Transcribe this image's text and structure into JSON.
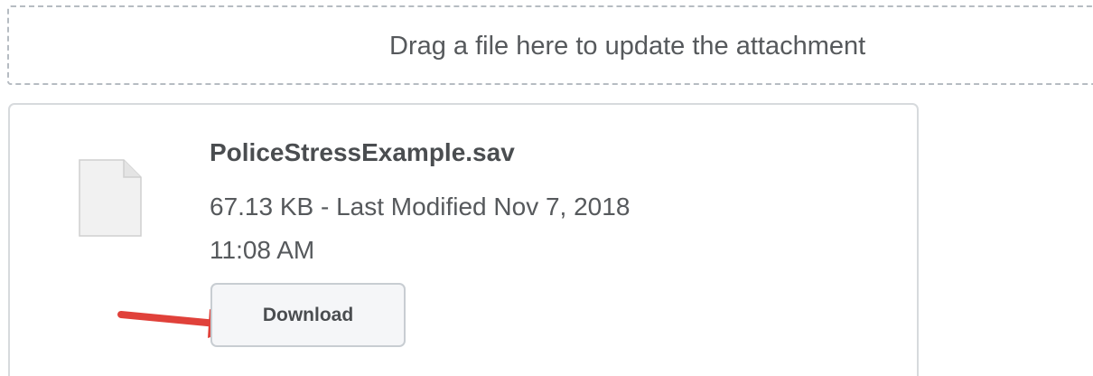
{
  "dropzone": {
    "text": "Drag a file here to update the attachment"
  },
  "attachment": {
    "file_name": "PoliceStressExample.sav",
    "meta_line_1": "67.13 KB - Last Modified Nov 7, 2018",
    "meta_line_2": "11:08 AM",
    "download_label": "Download",
    "icon": "file-icon"
  },
  "annotation": {
    "icon": "arrow-icon",
    "color": "#e0413a"
  }
}
